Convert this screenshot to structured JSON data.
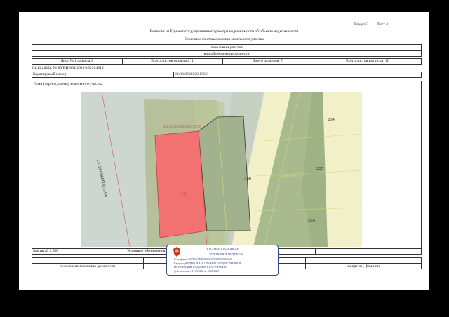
{
  "header": {
    "section": "Раздел 3",
    "sheet": "Лист 4",
    "title": "Выписка из Единого государственного реестра недвижимости об объекте недвижимости",
    "subtitle": "Описание местоположения земельного участка"
  },
  "object": {
    "type": "Земельный участок",
    "kind": "вид объекта недвижимости"
  },
  "sheet_row": {
    "sheet_no": "Лист № 1 раздела 3",
    "total_sheets_section": "Всего листов раздела 3: 1",
    "total_sections": "Всего разделов: 7",
    "total_sheets_extract": "Всего листов выписки: 10"
  },
  "record": {
    "date_number": "01.11.2022г. № КУВИ-001/2022-192514815",
    "cad_label": "Кадастровый номер:",
    "cad_value": "23:33:0606020:1566"
  },
  "plan": {
    "title": "План (чертеж, схема) земельного участка",
    "labels": {
      "top_parcel": "23:33:0606020:1133",
      "road": "23:00-0000000:1196",
      "red_parcel": "1134",
      "subject": "1566",
      "n264": "264",
      "n265": "265",
      "n265_full": "23:33:0606020:265",
      "n266": "266"
    }
  },
  "footer": {
    "scale": "Масштаб 1:500",
    "legend": "Условные обозначения:",
    "position_label": "полное наименование должности",
    "initials_label": "инициалы, фамилия"
  },
  "stamp": {
    "line1": "ДОКУМЕНТ ПОДПИСАН",
    "line2": "ЭЛЕКТРОННОЙ ПОДПИСЬЮ",
    "cert": "Сертификат: 00f7512f74060f3103109926d81f99f0b9b8",
    "owner1": "Владелец: ФЕДЕРАЛЬНАЯ СЛУЖБА ГОСУДАРСТВЕННОЙ",
    "owner2": "РЕГИСТРАЦИИ, КАДАСТРА И КАРТОГРАФИИ",
    "valid": "Действителен: с 17.03.2022 по 10.06.2023"
  },
  "colors": {
    "map_gray": "#cdd6cf",
    "red_parcel": "#f27272",
    "green_parcel": "#a9ba8f",
    "yellow_band": "#f1f0c8",
    "stamp_border": "#3a4a8a"
  }
}
